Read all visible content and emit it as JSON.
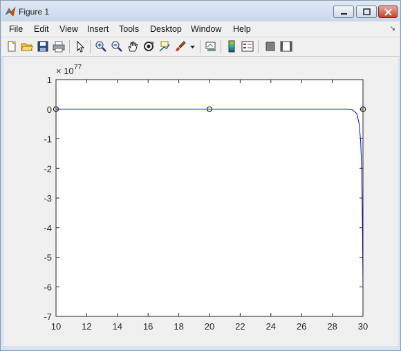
{
  "window": {
    "title": "Figure 1"
  },
  "menu": {
    "items": [
      "File",
      "Edit",
      "View",
      "Insert",
      "Tools",
      "Desktop",
      "Window",
      "Help"
    ]
  },
  "toolbar": {
    "icons": [
      "new-figure-icon",
      "open-file-icon",
      "save-icon",
      "print-icon",
      "edit-plot-arrow-icon",
      "zoom-in-icon",
      "zoom-out-icon",
      "pan-hand-icon",
      "rotate-3d-icon",
      "data-cursor-icon",
      "brush-icon",
      "brush-dropdown-icon",
      "link-plot-icon",
      "insert-colorbar-icon",
      "insert-legend-icon",
      "hide-plot-tools-icon",
      "show-plot-tools-icon"
    ]
  },
  "chart_data": {
    "type": "line",
    "xlim": [
      10,
      30
    ],
    "ylim": [
      -7,
      1
    ],
    "x_ticks": [
      "10",
      "12",
      "14",
      "16",
      "18",
      "20",
      "22",
      "24",
      "26",
      "28",
      "30"
    ],
    "y_ticks": [
      "1",
      "0",
      "-1",
      "-2",
      "-3",
      "-4",
      "-5",
      "-6",
      "-7"
    ],
    "y_exponent": "77",
    "y_exponent_prefix": "× 10",
    "grid": false,
    "series": [
      {
        "style": "line",
        "color": "#0000ff",
        "x": [
          10,
          20,
          28.8,
          29.3,
          29.6,
          29.75,
          29.85,
          29.92,
          29.97,
          30
        ],
        "y": [
          0,
          0,
          0,
          -0.02,
          -0.15,
          -0.5,
          -1.1,
          -2.0,
          -4.0,
          -6.1
        ]
      },
      {
        "style": "markers",
        "marker": "circle",
        "color": "#000000",
        "x": [
          10,
          20,
          30
        ],
        "y": [
          0,
          0,
          0
        ]
      }
    ]
  }
}
